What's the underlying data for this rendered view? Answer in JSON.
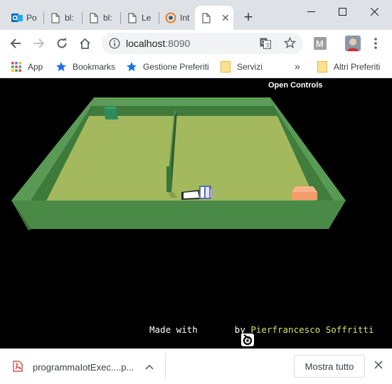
{
  "tabs": [
    {
      "title": "Po",
      "icon": "outlook-icon"
    },
    {
      "title": "bl:",
      "icon": "document-icon"
    },
    {
      "title": "bl:",
      "icon": "document-icon"
    },
    {
      "title": "Le",
      "icon": "document-icon"
    },
    {
      "title": "Int",
      "icon": "blender-icon"
    },
    {
      "title": "",
      "icon": "document-icon",
      "active": true
    }
  ],
  "new_tab_label": "+",
  "window_controls": {
    "minimize": "—",
    "maximize": "☐",
    "close": "✕"
  },
  "address_bar": {
    "host": "localhost",
    "port": ":8090"
  },
  "bookmarks": {
    "apps": "App",
    "items": [
      "Bookmarks",
      "Gestione Preferiti",
      "Servizi"
    ],
    "overflow": "»",
    "other": "Altri Preferiti"
  },
  "scene": {
    "open_controls": "Open Controls",
    "credit_prefix": "Made with ",
    "credit_by": " by ",
    "credit_author": "Pierfrancesco Soffritti",
    "colors": {
      "floor": "#a4b85d",
      "walls": "#4a8a47",
      "box_green": "#2e8a5d",
      "box_orange": "#f59a6a",
      "background": "#000000"
    }
  },
  "download": {
    "filename": "programmaIotExec....p...",
    "show_all": "Mostra tutto"
  }
}
